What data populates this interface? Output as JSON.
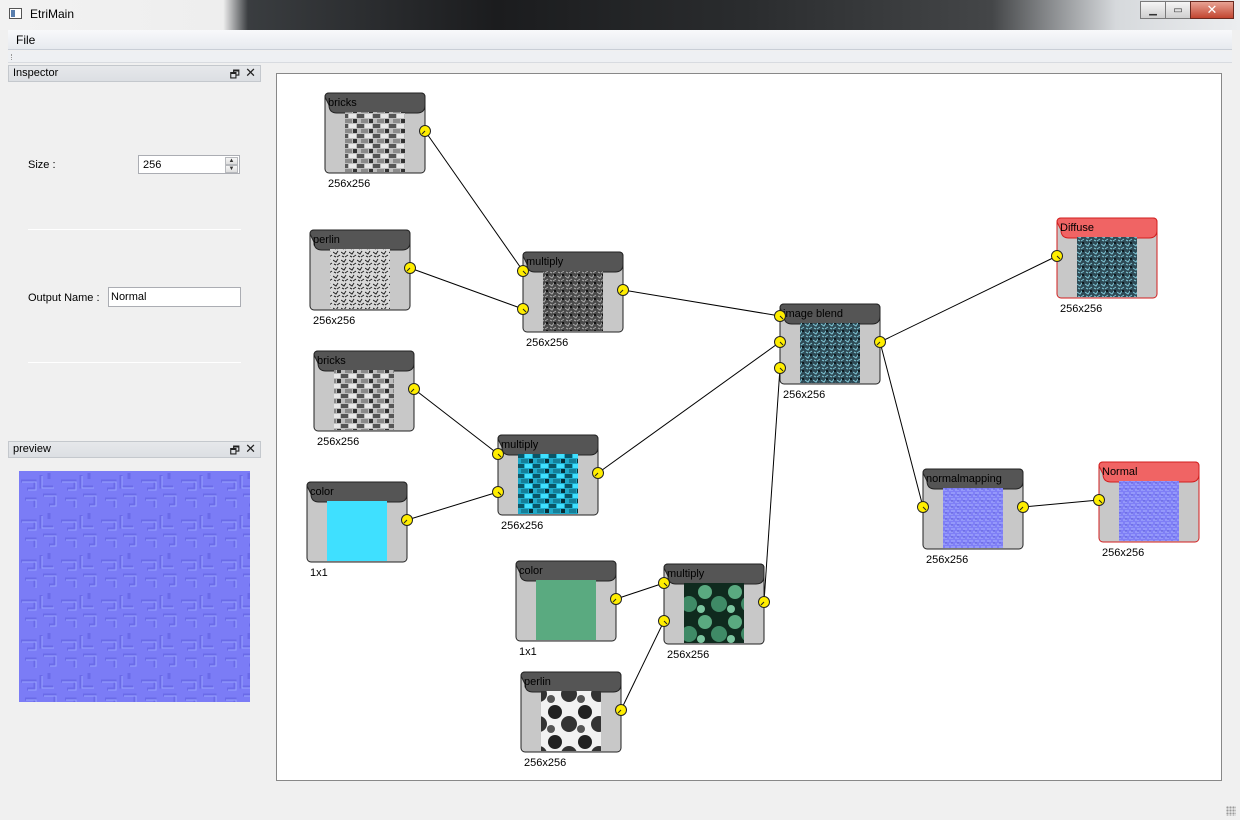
{
  "window": {
    "title": "EtriMain"
  },
  "menu": {
    "file_label": "File"
  },
  "inspector": {
    "title": "Inspector",
    "size_label": "Size :",
    "size_value": "256",
    "output_label": "Output Name :",
    "output_value": "Normal"
  },
  "preview": {
    "title": "preview"
  },
  "nodes": [
    {
      "id": "bricks1",
      "label": "bricks",
      "caption": "256x256",
      "thumb": "bricks-gray",
      "kind": "normal"
    },
    {
      "id": "perlin1",
      "label": "perlin",
      "caption": "256x256",
      "thumb": "noise-gray",
      "kind": "normal"
    },
    {
      "id": "multiply1",
      "label": "multiply",
      "caption": "256x256",
      "thumb": "noise-dark",
      "kind": "normal"
    },
    {
      "id": "bricks2",
      "label": "bricks",
      "caption": "256x256",
      "thumb": "bricks-gray",
      "kind": "normal"
    },
    {
      "id": "color1",
      "label": "color",
      "caption": "1x1",
      "thumb": "solid-cyan",
      "kind": "normal"
    },
    {
      "id": "multiply2",
      "label": "multiply",
      "caption": "256x256",
      "thumb": "bricks-cyan",
      "kind": "normal"
    },
    {
      "id": "imageblend",
      "label": "image blend",
      "caption": "256x256",
      "thumb": "noise-teal",
      "kind": "normal"
    },
    {
      "id": "diffuse",
      "label": "Diffuse",
      "caption": "256x256",
      "thumb": "noise-teal",
      "kind": "output"
    },
    {
      "id": "color2",
      "label": "color",
      "caption": "1x1",
      "thumb": "solid-green",
      "kind": "normal"
    },
    {
      "id": "multiply3",
      "label": "multiply",
      "caption": "256x256",
      "thumb": "blobs-green",
      "kind": "normal"
    },
    {
      "id": "perlin2",
      "label": "perlin",
      "caption": "256x256",
      "thumb": "blobs-gray",
      "kind": "normal"
    },
    {
      "id": "normalmapping",
      "label": "normalmapping",
      "caption": "256x256",
      "thumb": "normal-blue",
      "kind": "normal"
    },
    {
      "id": "normalout",
      "label": "Normal",
      "caption": "256x256",
      "thumb": "normal-blue",
      "kind": "output"
    }
  ],
  "colors": {
    "node_body": "#c8c8c8",
    "node_header": "#555555",
    "output_header": "#f06464",
    "port": "#ffee00",
    "cyan": "#3fe0ff",
    "green": "#5aaa80",
    "normal_blue": "#7f7fff"
  }
}
